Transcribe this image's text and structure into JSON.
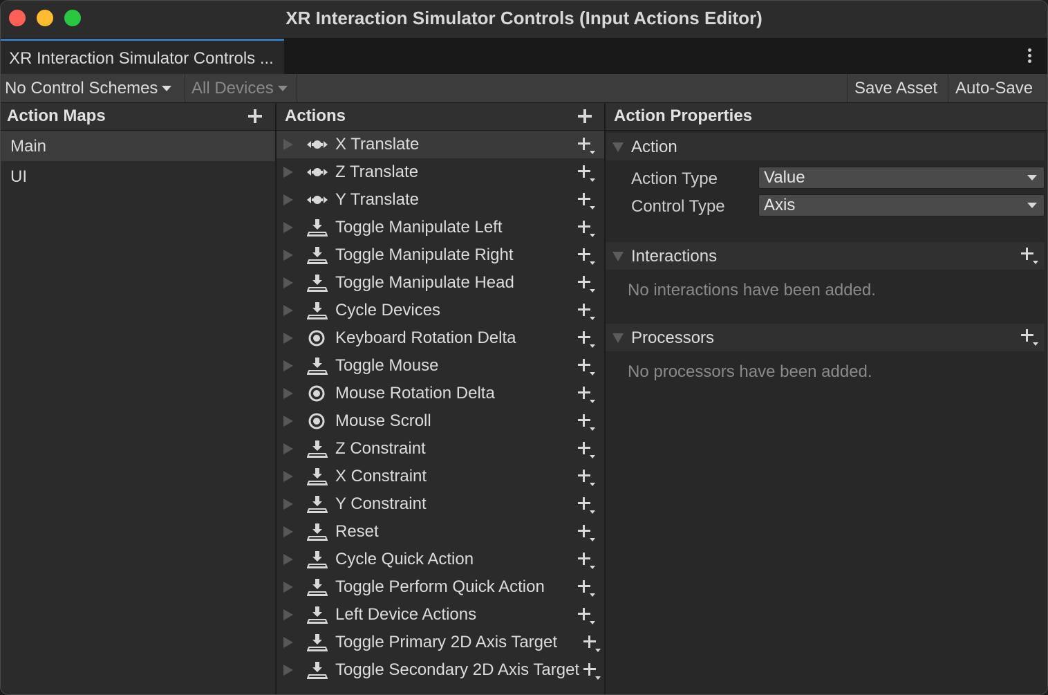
{
  "window": {
    "title": "XR Interaction Simulator Controls (Input Actions Editor)"
  },
  "tab": {
    "label": "XR Interaction Simulator Controls ..."
  },
  "toolbar": {
    "control_schemes": "No Control Schemes",
    "devices": "All Devices",
    "save_asset": "Save Asset",
    "auto_save": "Auto-Save"
  },
  "action_maps": {
    "header": "Action Maps",
    "items": [
      {
        "label": "Main",
        "selected": true
      },
      {
        "label": "UI",
        "selected": false
      }
    ]
  },
  "actions": {
    "header": "Actions",
    "items": [
      {
        "label": "X Translate",
        "icon": "axis-arrows-icon",
        "selected": true
      },
      {
        "label": "Z Translate",
        "icon": "axis-arrows-icon"
      },
      {
        "label": "Y Translate",
        "icon": "axis-arrows-icon"
      },
      {
        "label": "Toggle Manipulate Left",
        "icon": "button-press-icon"
      },
      {
        "label": "Toggle Manipulate Right",
        "icon": "button-press-icon"
      },
      {
        "label": "Toggle Manipulate Head",
        "icon": "button-press-icon"
      },
      {
        "label": "Cycle Devices",
        "icon": "button-press-icon"
      },
      {
        "label": "Keyboard Rotation Delta",
        "icon": "value-ring-icon"
      },
      {
        "label": "Toggle Mouse",
        "icon": "button-press-icon"
      },
      {
        "label": "Mouse Rotation Delta",
        "icon": "value-ring-icon"
      },
      {
        "label": "Mouse Scroll",
        "icon": "value-ring-icon"
      },
      {
        "label": "Z Constraint",
        "icon": "button-press-icon"
      },
      {
        "label": "X Constraint",
        "icon": "button-press-icon"
      },
      {
        "label": "Y Constraint",
        "icon": "button-press-icon"
      },
      {
        "label": "Reset",
        "icon": "button-press-icon"
      },
      {
        "label": "Cycle Quick Action",
        "icon": "button-press-icon"
      },
      {
        "label": "Toggle Perform Quick Action",
        "icon": "button-press-icon"
      },
      {
        "label": "Left Device Actions",
        "icon": "button-press-icon"
      },
      {
        "label": "Toggle Primary 2D Axis Target",
        "icon": "button-press-icon"
      },
      {
        "label": "Toggle Secondary 2D Axis Target",
        "icon": "button-press-icon"
      }
    ]
  },
  "properties": {
    "header": "Action Properties",
    "action_section": {
      "label": "Action",
      "action_type_label": "Action Type",
      "action_type_value": "Value",
      "control_type_label": "Control Type",
      "control_type_value": "Axis"
    },
    "interactions": {
      "label": "Interactions",
      "empty": "No interactions have been added."
    },
    "processors": {
      "label": "Processors",
      "empty": "No processors have been added."
    }
  }
}
